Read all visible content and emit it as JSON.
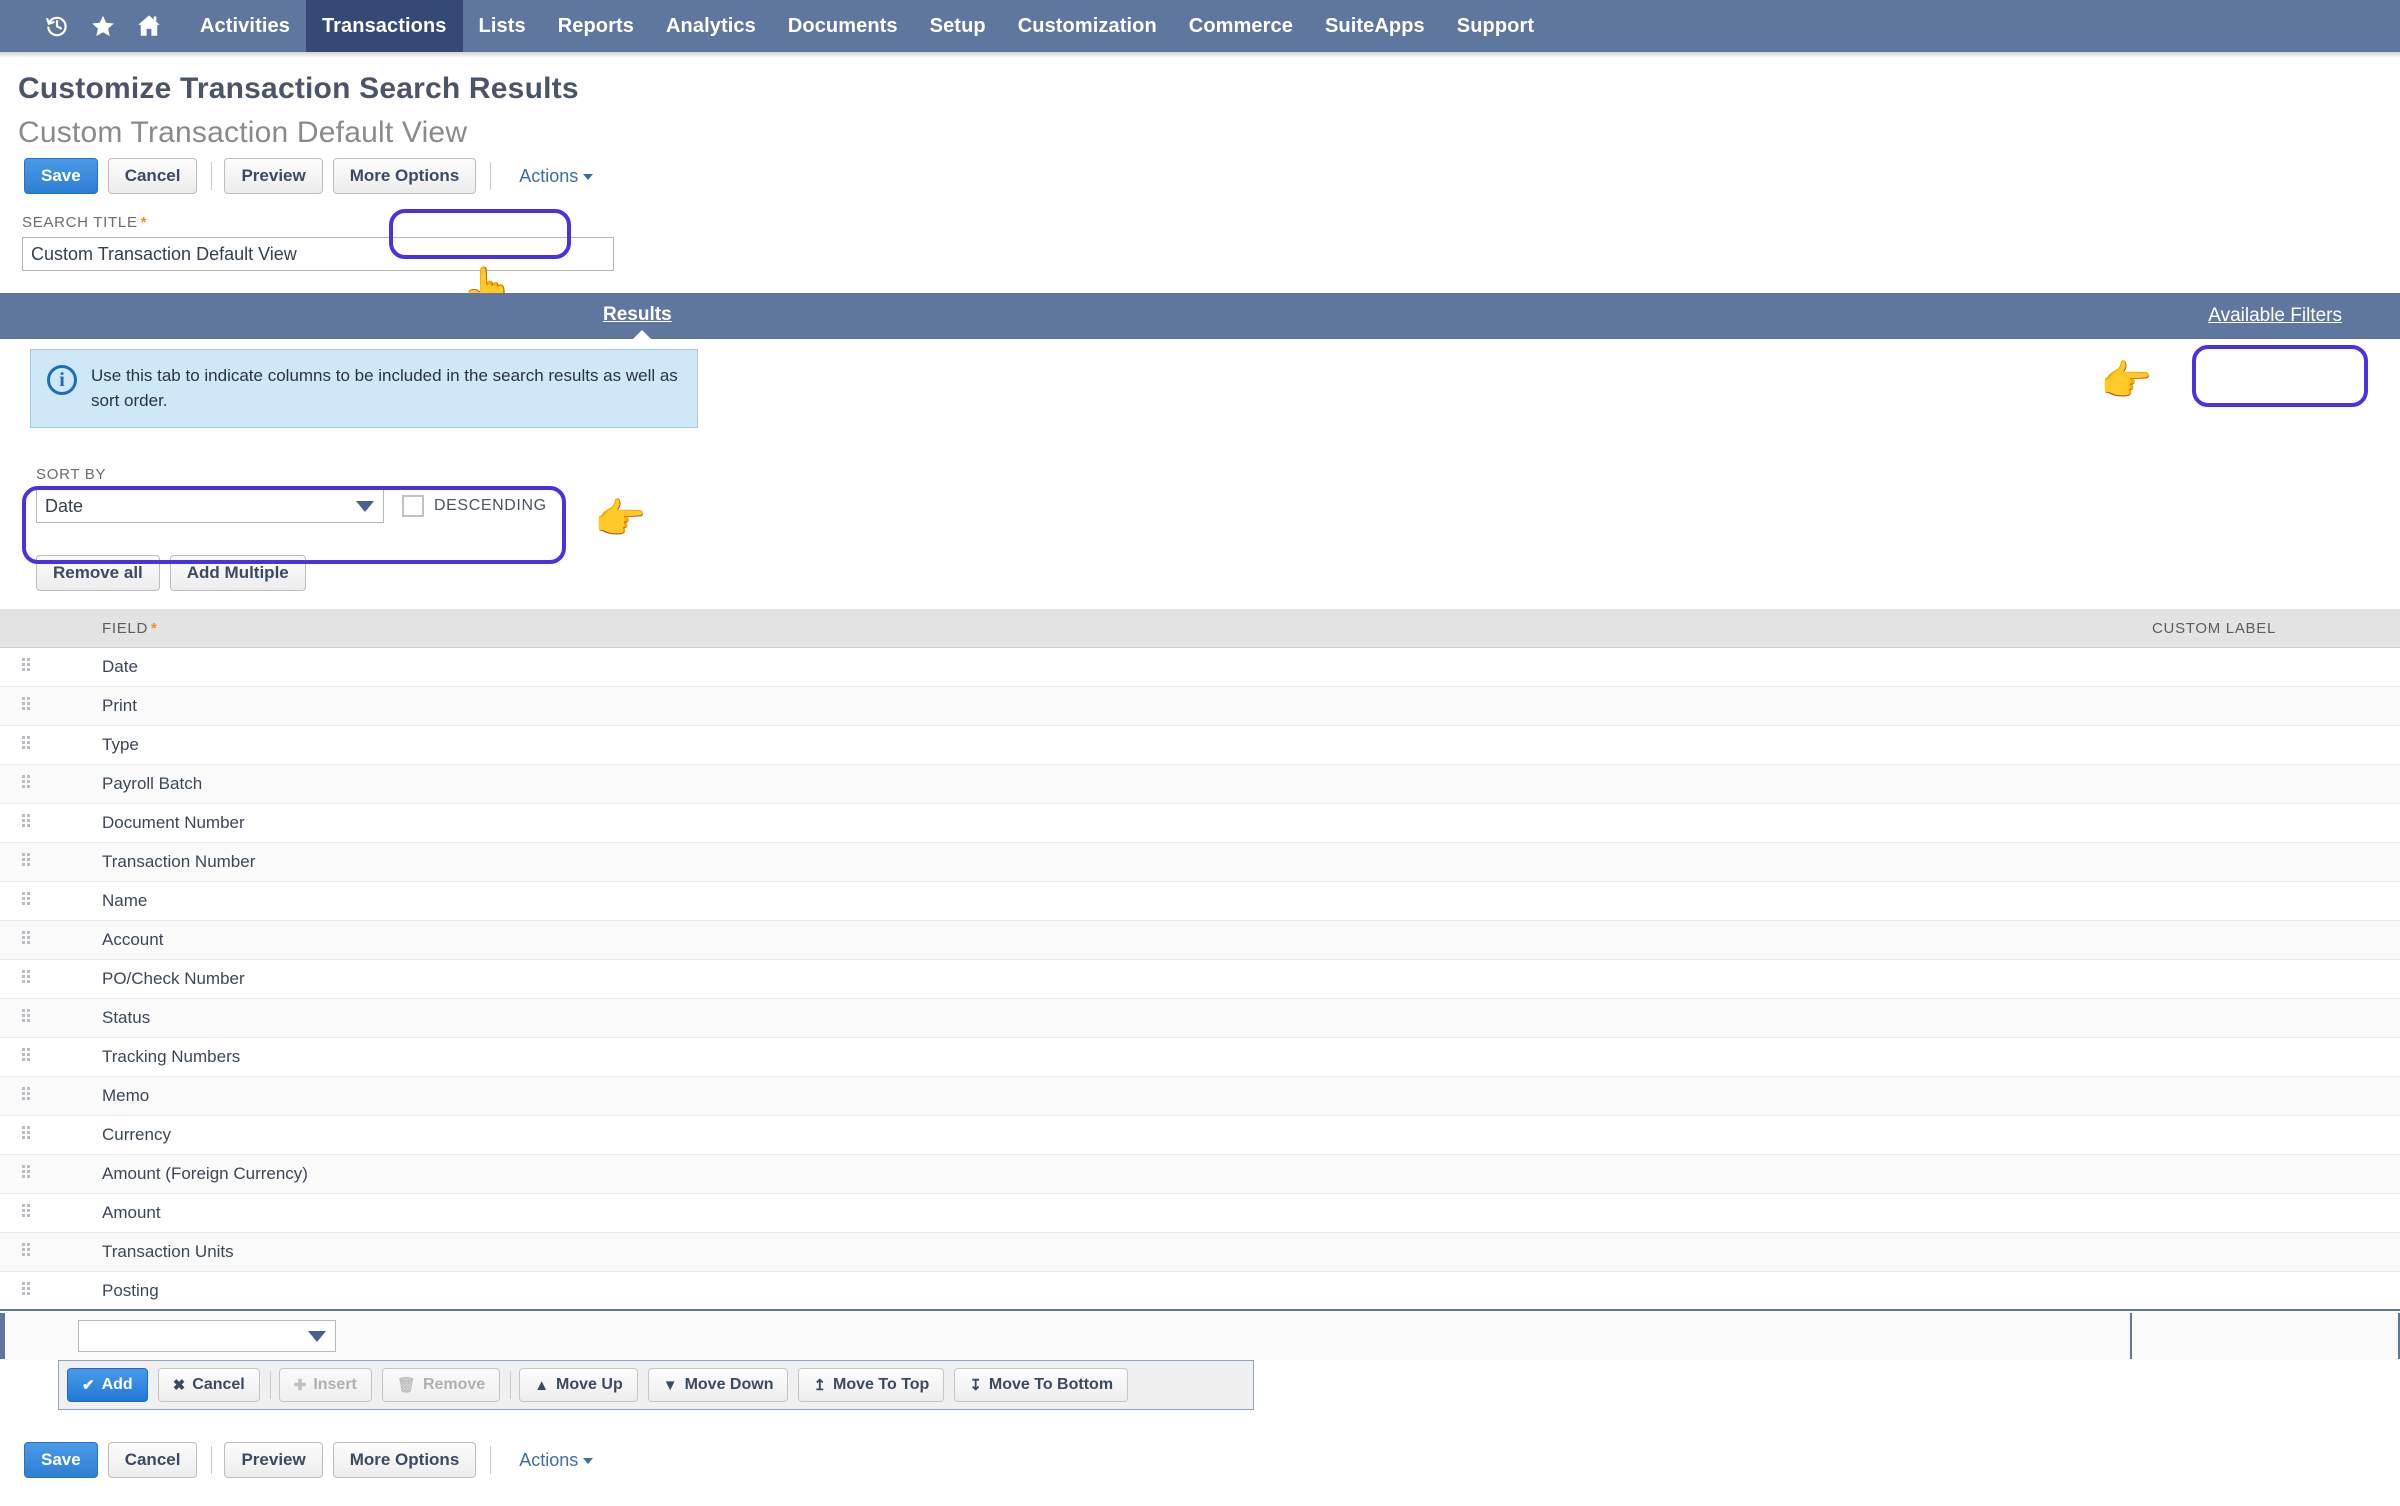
{
  "navbar": {
    "icons": [
      {
        "name": "recent-history-icon",
        "glyph": "recent"
      },
      {
        "name": "favorites-star-icon",
        "glyph": "star"
      },
      {
        "name": "home-icon",
        "glyph": "home"
      }
    ],
    "items": [
      {
        "label": "Activities",
        "active": false
      },
      {
        "label": "Transactions",
        "active": true
      },
      {
        "label": "Lists",
        "active": false
      },
      {
        "label": "Reports",
        "active": false
      },
      {
        "label": "Analytics",
        "active": false
      },
      {
        "label": "Documents",
        "active": false
      },
      {
        "label": "Setup",
        "active": false
      },
      {
        "label": "Customization",
        "active": false
      },
      {
        "label": "Commerce",
        "active": false
      },
      {
        "label": "SuiteApps",
        "active": false
      },
      {
        "label": "Support",
        "active": false
      }
    ],
    "bg_color": "#5f779f",
    "active_bg_color": "#344a74"
  },
  "header": {
    "title": "Customize Transaction Search Results",
    "subtitle": "Custom Transaction Default View"
  },
  "toolbar": {
    "save_label": "Save",
    "cancel_label": "Cancel",
    "preview_label": "Preview",
    "more_options_label": "More Options",
    "actions_label": "Actions"
  },
  "search_title": {
    "label": "SEARCH TITLE",
    "required_marker": "*",
    "value": "Custom Transaction Default View"
  },
  "tabs": {
    "active_tab": "Results",
    "available_filters_label": "Available Filters"
  },
  "info_banner": {
    "icon": "info-icon",
    "text": "Use this tab to indicate columns to be included in the search results as well as sort order."
  },
  "sort_by": {
    "label": "SORT BY",
    "value": "Date",
    "descending_label": "DESCENDING",
    "descending_checked": false
  },
  "list_actions": {
    "remove_all_label": "Remove all",
    "add_multiple_label": "Add Multiple"
  },
  "table": {
    "columns": [
      {
        "key": "grip",
        "label": ""
      },
      {
        "key": "field",
        "label": "FIELD",
        "required_marker": "*"
      },
      {
        "key": "custom_label",
        "label": "CUSTOM LABEL"
      }
    ],
    "rows": [
      {
        "field": "Date",
        "custom_label": ""
      },
      {
        "field": "Print",
        "custom_label": ""
      },
      {
        "field": "Type",
        "custom_label": ""
      },
      {
        "field": "Payroll Batch",
        "custom_label": ""
      },
      {
        "field": "Document Number",
        "custom_label": ""
      },
      {
        "field": "Transaction Number",
        "custom_label": ""
      },
      {
        "field": "Name",
        "custom_label": ""
      },
      {
        "field": "Account",
        "custom_label": ""
      },
      {
        "field": "PO/Check Number",
        "custom_label": ""
      },
      {
        "field": "Status",
        "custom_label": ""
      },
      {
        "field": "Tracking Numbers",
        "custom_label": ""
      },
      {
        "field": "Memo",
        "custom_label": ""
      },
      {
        "field": "Currency",
        "custom_label": ""
      },
      {
        "field": "Amount (Foreign Currency)",
        "custom_label": ""
      },
      {
        "field": "Amount",
        "custom_label": ""
      },
      {
        "field": "Transaction Units",
        "custom_label": ""
      },
      {
        "field": "Posting",
        "custom_label": ""
      }
    ],
    "new_row": {
      "field_value": "",
      "custom_label_value": ""
    }
  },
  "sublist_toolbar": {
    "buttons": [
      {
        "label": "Add",
        "glyph": "✔",
        "primary": true,
        "disabled": false,
        "name": "add-button"
      },
      {
        "label": "Cancel",
        "glyph": "✖",
        "primary": false,
        "disabled": false,
        "name": "cancel-row-button"
      },
      {
        "label": "Insert",
        "glyph": "+",
        "primary": false,
        "disabled": true,
        "name": "insert-button"
      },
      {
        "label": "Remove",
        "glyph": "Ὕ1",
        "primary": false,
        "disabled": true,
        "name": "remove-button"
      },
      {
        "label": "Move Up",
        "glyph": "▲",
        "primary": false,
        "disabled": false,
        "name": "move-up-button"
      },
      {
        "label": "Move Down",
        "glyph": "▼",
        "primary": false,
        "disabled": false,
        "name": "move-down-button"
      },
      {
        "label": "Move To Top",
        "glyph": "⤒",
        "primary": false,
        "disabled": false,
        "name": "move-to-top-button"
      },
      {
        "label": "Move To Bottom",
        "glyph": "⤓",
        "primary": false,
        "disabled": false,
        "name": "move-to-bottom-button"
      }
    ]
  },
  "annotations": {
    "highlight_color": "#4b31e0",
    "pointer_glyph_down": "👆",
    "pointer_glyph_right": "👉"
  }
}
